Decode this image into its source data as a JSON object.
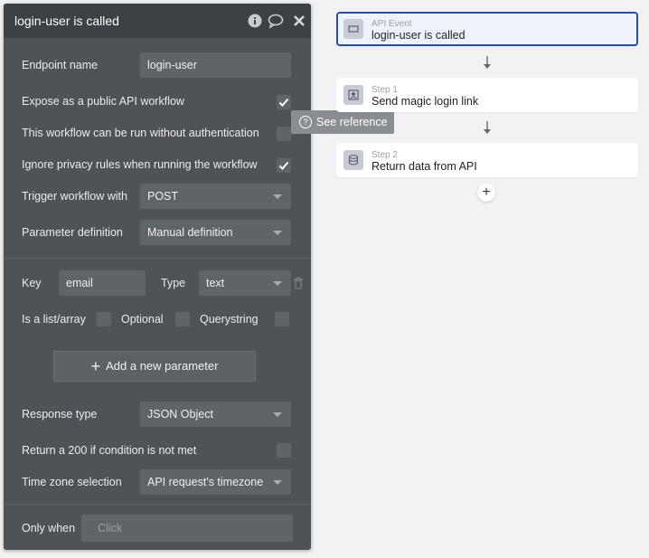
{
  "panel": {
    "title": "login-user is called",
    "endpoint_name_label": "Endpoint name",
    "endpoint_name_value": "login-user",
    "expose_label": "Expose as a public API workflow",
    "expose_checked": true,
    "no_auth_label": "This workflow can be run without authentication",
    "no_auth_checked": false,
    "ignore_privacy_label": "Ignore privacy rules when running the workflow",
    "ignore_privacy_checked": true,
    "trigger_label": "Trigger workflow with",
    "trigger_value": "POST",
    "param_def_label": "Parameter definition",
    "param_def_value": "Manual definition",
    "key_label": "Key",
    "key_value": "email",
    "type_label": "Type",
    "type_value": "text",
    "is_list_label": "Is a list/array",
    "optional_label": "Optional",
    "querystring_label": "Querystring",
    "add_param_label": "Add a new parameter",
    "response_type_label": "Response type",
    "response_type_value": "JSON Object",
    "return200_label": "Return a 200 if condition is not met",
    "timezone_label": "Time zone selection",
    "timezone_value": "API request's timezone",
    "only_when_label": "Only when",
    "only_when_placeholder": "Click"
  },
  "tooltip": {
    "text": "See reference"
  },
  "workflow": {
    "event": {
      "kind": "API Event",
      "name": "login-user is called"
    },
    "steps": [
      {
        "step": "Step 1",
        "name": "Send magic login link"
      },
      {
        "step": "Step 2",
        "name": "Return data from API"
      }
    ],
    "add_step": "+"
  },
  "colors": {
    "panel_bg": "#4e5358",
    "header_bg": "#3c4145",
    "field_bg": "#5f6469",
    "selected_border": "#2a4ea0"
  }
}
